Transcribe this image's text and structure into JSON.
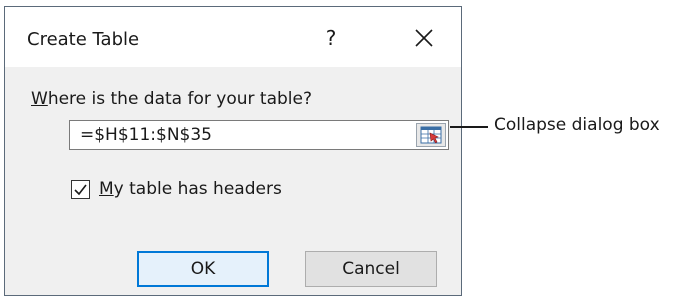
{
  "dialog": {
    "title": "Create Table",
    "help_glyph": "?",
    "close_icon": "close-icon",
    "prompt_underlined": "W",
    "prompt_rest": "here is the data for your table?",
    "range_value": "=$H$11:$N$35",
    "collapse_icon": "collapse-dialog-icon",
    "headers_checked": true,
    "checkbox_underlined": "M",
    "checkbox_rest": "y table has headers",
    "ok_label": "OK",
    "cancel_label": "Cancel"
  },
  "callout": {
    "text": "Collapse dialog box"
  },
  "colors": {
    "dialog_border": "#5b6a7a",
    "dialog_background": "#f0f0f0",
    "default_button_border": "#0078d7"
  }
}
